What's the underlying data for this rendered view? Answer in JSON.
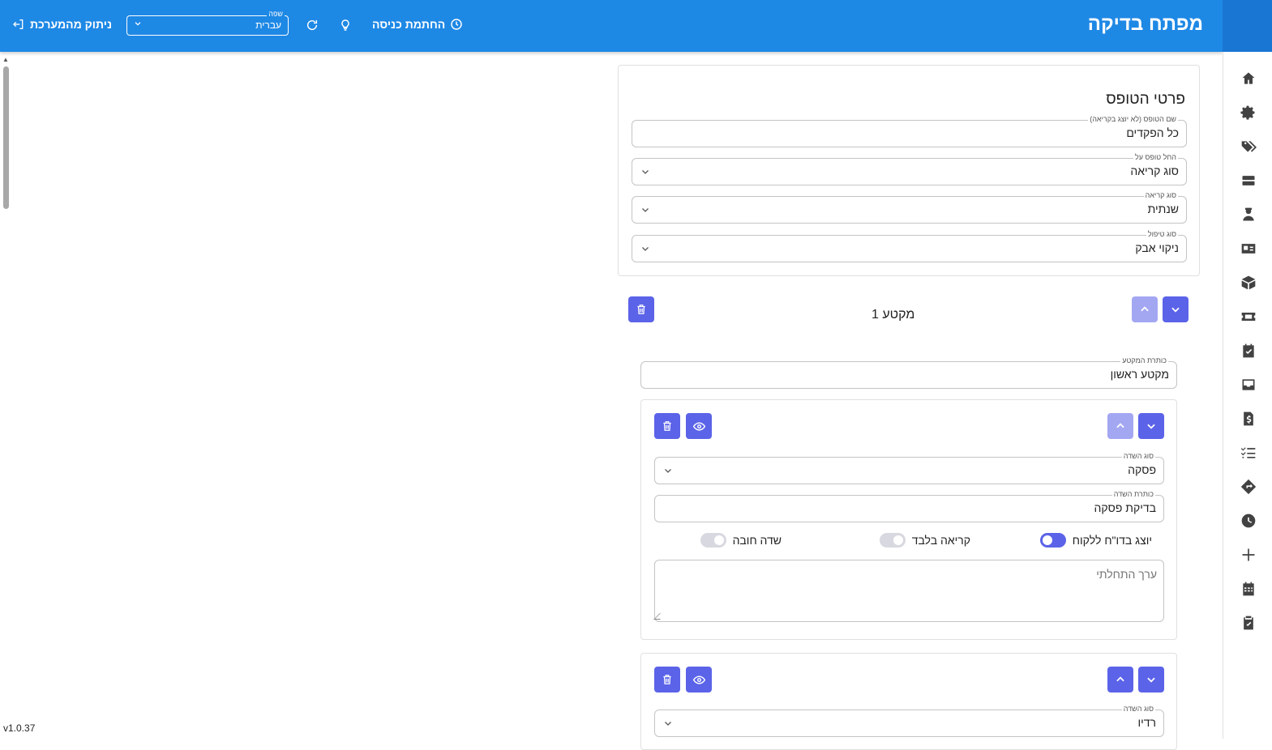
{
  "header": {
    "app_title": "מפתח בדיקה",
    "logout_label": "ניתוק מהמערכת",
    "language": {
      "label": "שפה",
      "value": "עברית"
    },
    "clock_in_label": "החתמת כניסה"
  },
  "sidebar": {
    "items": [
      "home-icon",
      "settings-icon",
      "tags-icon",
      "storage-icon",
      "worker-icon",
      "id-card-icon",
      "box-icon",
      "ticket-icon",
      "task-check-icon",
      "inbox-icon",
      "invoice-icon",
      "checklist-icon",
      "directions-icon",
      "clock-icon",
      "plus-icon",
      "calendar-icon",
      "clipboard-check-icon"
    ]
  },
  "version": "v1.0.37",
  "form_details": {
    "title": "פרטי הטופס",
    "name": {
      "label": "שם הטופס (לא יוצג בקריאה)",
      "value": "כל הפקדים"
    },
    "apply_on": {
      "label": "החל טופס על",
      "value": "סוג קריאה"
    },
    "call_type": {
      "label": "סוג קריאה",
      "value": "שנתית"
    },
    "treatment_type": {
      "label": "סוג טיפול",
      "value": "ניקוי אבק"
    }
  },
  "section": {
    "title": "מקטע 1",
    "header_field": {
      "label": "כותרת המקטע",
      "value": "מקטע ראשון"
    }
  },
  "field_cards": [
    {
      "type": {
        "label": "סוג השדה",
        "value": "פסקה"
      },
      "title": {
        "label": "כותרת השדה",
        "value": "בדיקת פסקה"
      },
      "toggles": {
        "show_in_report": "יוצג בדו\"ח ללקוח",
        "read_only": "קריאה בלבד",
        "required": "שדה חובה"
      },
      "default_placeholder": "ערך התחלתי"
    },
    {
      "type": {
        "label": "סוג השדה",
        "value": "רדיו"
      }
    }
  ],
  "colors": {
    "header": "#1e88e5",
    "accent": "#5b63e8"
  }
}
